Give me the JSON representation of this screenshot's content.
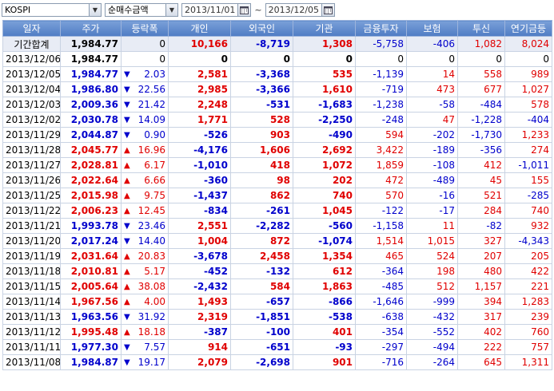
{
  "toolbar": {
    "market": "KOSPI",
    "metric": "순매수금액",
    "date_from": "2013/11/01",
    "date_to": "2013/12/05",
    "separator": "~"
  },
  "columns": [
    "일자",
    "주가",
    "등락폭",
    "개인",
    "외국인",
    "기관",
    "금융투자",
    "보험",
    "투신",
    "연기금등"
  ],
  "colors": {
    "up": "#e00000",
    "down": "#0000cc",
    "header": "#5a86cb"
  },
  "total": {
    "date": "기간합계",
    "price": "1,984.77",
    "change": "0",
    "individual": "10,166",
    "foreign": "-8,719",
    "institution": "1,308",
    "fin": "-5,758",
    "ins": "-406",
    "trust": "1,082",
    "pension": "8,024"
  },
  "rows": [
    {
      "date": "2013/12/06",
      "price": "1,984.77",
      "dir": "none",
      "change": "0",
      "individual": "0",
      "foreign": "0",
      "institution": "0",
      "fin": "0",
      "ins": "0",
      "trust": "0",
      "pension": "0"
    },
    {
      "date": "2013/12/05",
      "price": "1,984.77",
      "dir": "down",
      "change": "2.03",
      "individual": "2,581",
      "foreign": "-3,368",
      "institution": "535",
      "fin": "-1,139",
      "ins": "14",
      "trust": "558",
      "pension": "989"
    },
    {
      "date": "2013/12/04",
      "price": "1,986.80",
      "dir": "down",
      "change": "22.56",
      "individual": "2,985",
      "foreign": "-3,366",
      "institution": "1,610",
      "fin": "-719",
      "ins": "473",
      "trust": "677",
      "pension": "1,027"
    },
    {
      "date": "2013/12/03",
      "price": "2,009.36",
      "dir": "down",
      "change": "21.42",
      "individual": "2,248",
      "foreign": "-531",
      "institution": "-1,683",
      "fin": "-1,238",
      "ins": "-58",
      "trust": "-484",
      "pension": "578"
    },
    {
      "date": "2013/12/02",
      "price": "2,030.78",
      "dir": "down",
      "change": "14.09",
      "individual": "1,771",
      "foreign": "528",
      "institution": "-2,250",
      "fin": "-248",
      "ins": "47",
      "trust": "-1,228",
      "pension": "-404"
    },
    {
      "date": "2013/11/29",
      "price": "2,044.87",
      "dir": "down",
      "change": "0.90",
      "individual": "-526",
      "foreign": "903",
      "institution": "-490",
      "fin": "594",
      "ins": "-202",
      "trust": "-1,730",
      "pension": "1,233"
    },
    {
      "date": "2013/11/28",
      "price": "2,045.77",
      "dir": "up",
      "change": "16.96",
      "individual": "-4,176",
      "foreign": "1,606",
      "institution": "2,692",
      "fin": "3,422",
      "ins": "-189",
      "trust": "-356",
      "pension": "274"
    },
    {
      "date": "2013/11/27",
      "price": "2,028.81",
      "dir": "up",
      "change": "6.17",
      "individual": "-1,010",
      "foreign": "418",
      "institution": "1,072",
      "fin": "1,859",
      "ins": "-108",
      "trust": "412",
      "pension": "-1,011"
    },
    {
      "date": "2013/11/26",
      "price": "2,022.64",
      "dir": "up",
      "change": "6.66",
      "individual": "-360",
      "foreign": "98",
      "institution": "202",
      "fin": "472",
      "ins": "-489",
      "trust": "45",
      "pension": "155"
    },
    {
      "date": "2013/11/25",
      "price": "2,015.98",
      "dir": "up",
      "change": "9.75",
      "individual": "-1,437",
      "foreign": "862",
      "institution": "740",
      "fin": "570",
      "ins": "-16",
      "trust": "521",
      "pension": "-285"
    },
    {
      "date": "2013/11/22",
      "price": "2,006.23",
      "dir": "up",
      "change": "12.45",
      "individual": "-834",
      "foreign": "-261",
      "institution": "1,045",
      "fin": "-122",
      "ins": "-17",
      "trust": "284",
      "pension": "740"
    },
    {
      "date": "2013/11/21",
      "price": "1,993.78",
      "dir": "down",
      "change": "23.46",
      "individual": "2,551",
      "foreign": "-2,282",
      "institution": "-560",
      "fin": "-1,158",
      "ins": "11",
      "trust": "-82",
      "pension": "932"
    },
    {
      "date": "2013/11/20",
      "price": "2,017.24",
      "dir": "down",
      "change": "14.40",
      "individual": "1,004",
      "foreign": "872",
      "institution": "-1,074",
      "fin": "1,514",
      "ins": "1,015",
      "trust": "327",
      "pension": "-4,343"
    },
    {
      "date": "2013/11/19",
      "price": "2,031.64",
      "dir": "up",
      "change": "20.83",
      "individual": "-3,678",
      "foreign": "2,458",
      "institution": "1,354",
      "fin": "465",
      "ins": "524",
      "trust": "207",
      "pension": "205"
    },
    {
      "date": "2013/11/18",
      "price": "2,010.81",
      "dir": "up",
      "change": "5.17",
      "individual": "-452",
      "foreign": "-132",
      "institution": "612",
      "fin": "-364",
      "ins": "198",
      "trust": "480",
      "pension": "422"
    },
    {
      "date": "2013/11/15",
      "price": "2,005.64",
      "dir": "up",
      "change": "38.08",
      "individual": "-2,432",
      "foreign": "584",
      "institution": "1,863",
      "fin": "-485",
      "ins": "512",
      "trust": "1,157",
      "pension": "221"
    },
    {
      "date": "2013/11/14",
      "price": "1,967.56",
      "dir": "up",
      "change": "4.00",
      "individual": "1,493",
      "foreign": "-657",
      "institution": "-866",
      "fin": "-1,646",
      "ins": "-999",
      "trust": "394",
      "pension": "1,283"
    },
    {
      "date": "2013/11/13",
      "price": "1,963.56",
      "dir": "down",
      "change": "31.92",
      "individual": "2,319",
      "foreign": "-1,851",
      "institution": "-538",
      "fin": "-638",
      "ins": "-432",
      "trust": "317",
      "pension": "239"
    },
    {
      "date": "2013/11/12",
      "price": "1,995.48",
      "dir": "up",
      "change": "18.18",
      "individual": "-387",
      "foreign": "-100",
      "institution": "401",
      "fin": "-354",
      "ins": "-552",
      "trust": "402",
      "pension": "760"
    },
    {
      "date": "2013/11/11",
      "price": "1,977.30",
      "dir": "down",
      "change": "7.57",
      "individual": "914",
      "foreign": "-651",
      "institution": "-93",
      "fin": "-297",
      "ins": "-494",
      "trust": "222",
      "pension": "757"
    },
    {
      "date": "2013/11/08",
      "price": "1,984.87",
      "dir": "down",
      "change": "19.17",
      "individual": "2,079",
      "foreign": "-2,698",
      "institution": "901",
      "fin": "-716",
      "ins": "-264",
      "trust": "645",
      "pension": "1,311"
    }
  ]
}
